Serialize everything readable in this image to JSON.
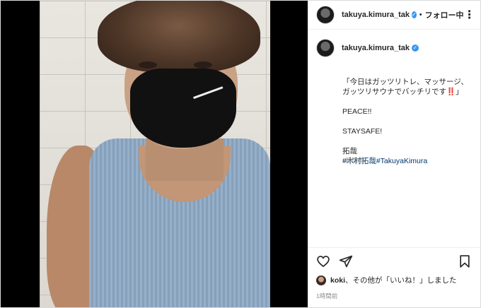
{
  "post": {
    "username": "takuya.kimura_tak",
    "separator": "•",
    "follow_label": "フォロー中",
    "more_label": "⋮"
  },
  "caption": {
    "username": "takuya.kimura_tak",
    "text": "「今日はガッツリトレ、マッサージ、\nガッツリサウナでバッチリです‼️」\n\nPEACE!!\n\nSTAYSAFE!\n\n拓哉",
    "hashtags": "#木村拓哉#TakuyaKimura",
    "time": "1時間前"
  },
  "likes": {
    "liker": "koki",
    "text_rest": "、その他が「いいね！」しました",
    "time": "1時間前"
  },
  "colors": {
    "verified": "#3897f0",
    "hashtag": "#00376b"
  },
  "icons": {
    "like": "heart-icon",
    "share": "send-icon",
    "save": "bookmark-icon"
  }
}
